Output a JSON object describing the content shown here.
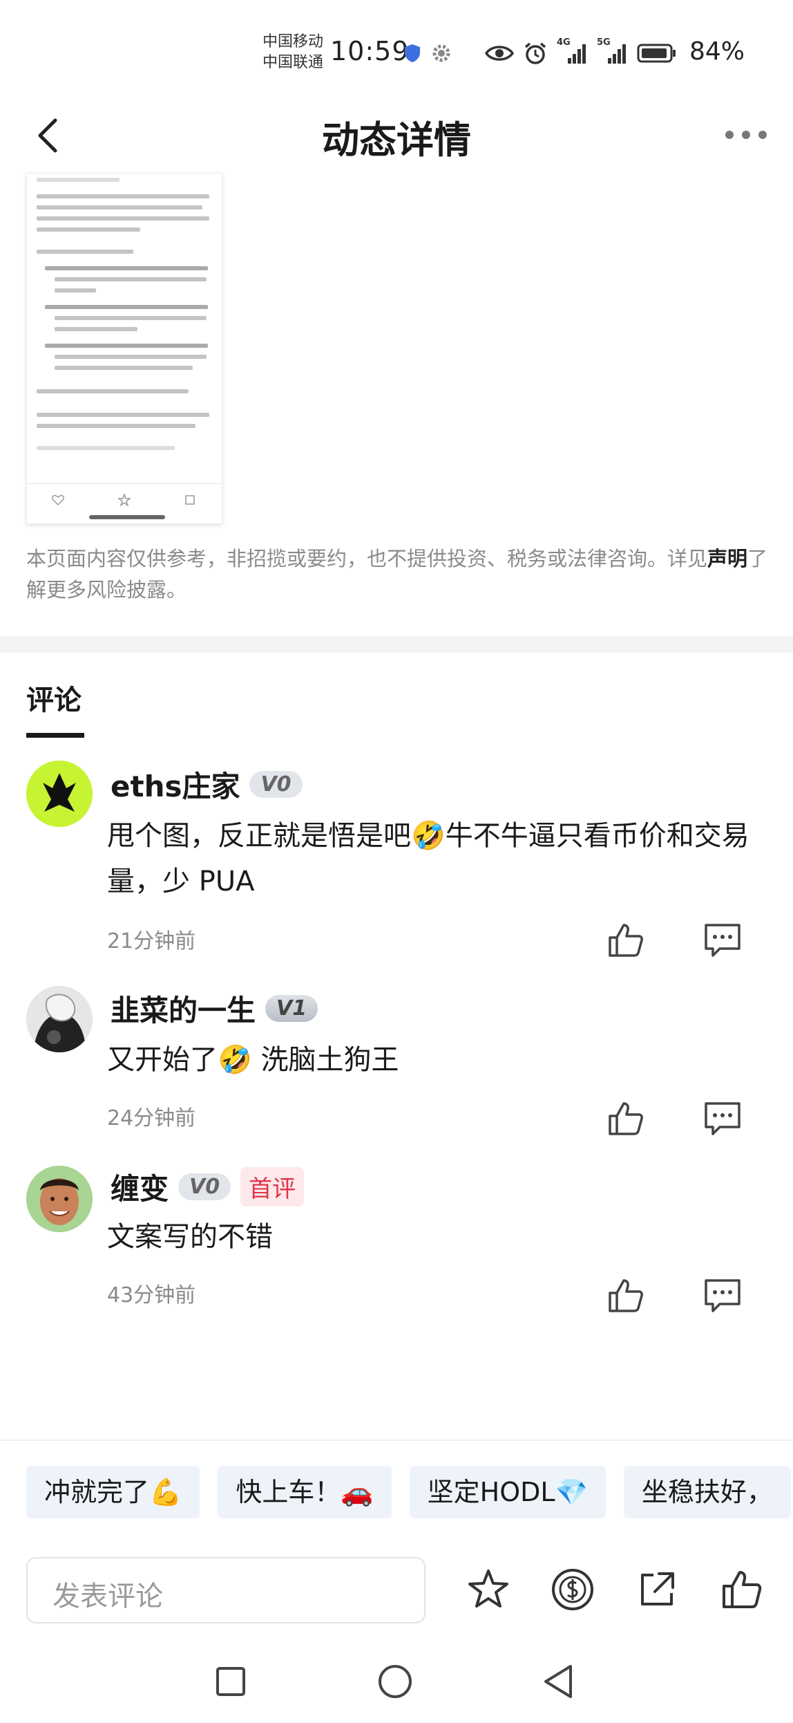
{
  "status_bar": {
    "carrier1": "中国移动",
    "carrier2": "中国联通",
    "time": "10:59",
    "net1": "4G",
    "net2": "5G",
    "battery": "84%"
  },
  "header": {
    "title": "动态详情"
  },
  "disclaimer": {
    "text_before": "本页面内容仅供参考，非招揽或要约，也不提供投资、税务或法律咨询。详见",
    "link": "声明",
    "text_after": "了解更多风险披露。"
  },
  "comments_tab": {
    "label": "评论"
  },
  "comments": [
    {
      "user": "eths庄家",
      "level": "V0",
      "text": "甩个图，反正就是悟是吧🤣牛不牛逼只看币价和交易量，少 PUA",
      "time": "21分钟前"
    },
    {
      "user": "韭菜的一生",
      "level": "V1",
      "text": "又开始了🤣 洗脑土狗王",
      "time": "24分钟前"
    },
    {
      "user": "缠变",
      "level": "V0",
      "badge": "首评",
      "text": "文案写的不错",
      "time": "43分钟前"
    }
  ],
  "quick_replies": [
    "冲就完了💪",
    "快上车！🚗",
    "坚定HODL💎",
    "坐稳扶好，"
  ],
  "composer": {
    "placeholder": "发表评论"
  },
  "colors": {
    "accent_link": "#222222",
    "first_badge": "#e0354a",
    "chip_bg": "#eef3fa",
    "avatar1_bg": "#c6f432"
  }
}
